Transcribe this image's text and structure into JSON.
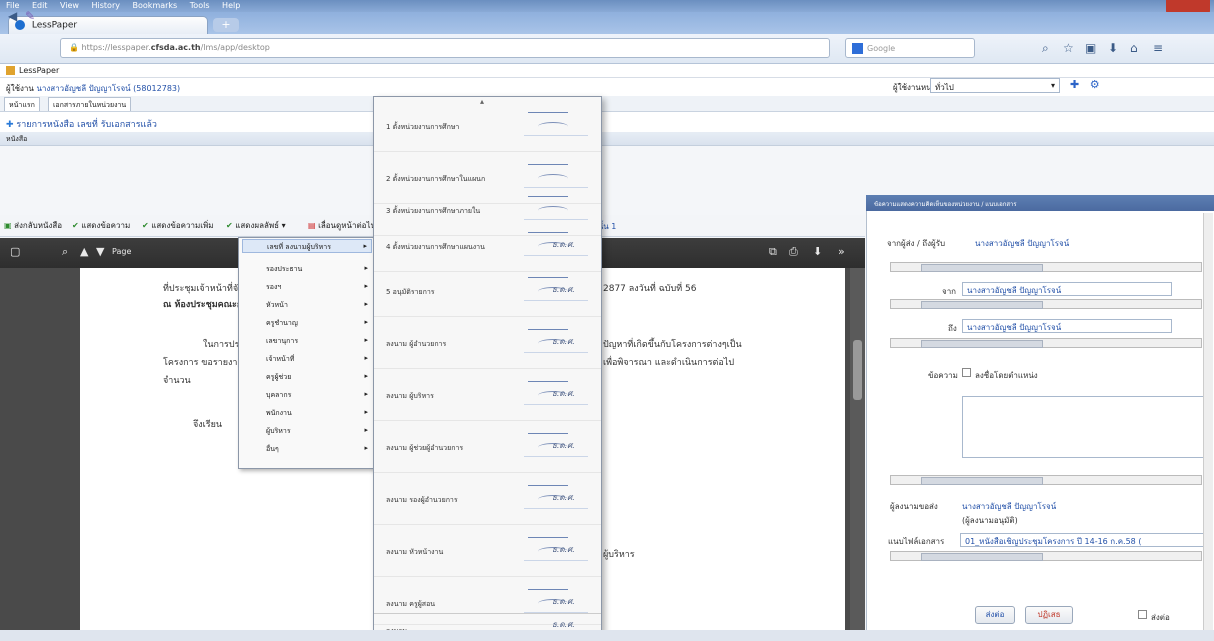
{
  "browser": {
    "menubar": [
      "File",
      "Edit",
      "View",
      "History",
      "Bookmarks",
      "Tools",
      "Help"
    ],
    "tab_title": "LessPaper",
    "url_prefix": "https://lesspaper.",
    "url_domain": "cfsda.ac.th",
    "url_suffix": "/lms/app/desktop",
    "search_placeholder": "Google"
  },
  "app": {
    "title": "LessPaper",
    "user_label": "ผู้ใช้งาน",
    "user_name": "นางสาวอัญชลี ปัญญาโรจน์ (58012783)",
    "unit_label": "ผู้ใช้งานหน่วยงาน",
    "unit_value": "ทั่วไป",
    "tabs": [
      "หน้าแรก",
      "เอกสารภายในหน่วยงาน"
    ],
    "received_title": "รายการหนังสือ เลขที่ รับเอกสารแล้ว",
    "bookrow": "หนังสือ"
  },
  "toolbar": {
    "btn1": "ส่งกลับหนังสือ",
    "btn2": "แสดงข้อความ",
    "btn3": "แสดงข้อความเพิ่ม",
    "btn4": "แสดงผลลัพธ์",
    "btn5": "เลื่อนดูหน้าต่อไป",
    "pagenav": "หน้าที่ 1  ใหม่  1  เท่านั้น  1"
  },
  "viewer": {
    "page_label": "Page",
    "text1": "ที่ประชุมเจ้าหน้าที่จัดการศึกษา",
    "text2": "ณ ห้องประชุมคณะกรรมการ",
    "text3": "ในการประชุมครั้งนี้",
    "text4": "โครงการ ขอรายงาน",
    "text5": "จำนวน",
    "text6": "จึงเรียน",
    "text7": "2877 ลงวันที่ ฉบับที่ 56",
    "text8": "ปัญหาที่เกิดขึ้นกับโครงการต่างๆเป็น",
    "text9": "เพื่อพิจารณา และดำเนินการต่อไป",
    "text10": "ผู้บริหาร"
  },
  "menu1": {
    "items": [
      "เลขที่ ลงนามผู้บริหาร",
      "รองประธาน",
      "รองฯ",
      "หัวหน้า",
      "ครูชำนาญ",
      "เลขานุการ",
      "เจ้าหน้าที่",
      "ครูผู้ช่วย",
      "บุคลากร",
      "พนักงาน",
      "ผู้บริหาร",
      "อื่นๆ"
    ]
  },
  "menu2": {
    "items": [
      "1 ตั้งหน่วยงานการศึกษา",
      "2 ตั้งหน่วยงานการศึกษาในแผนก",
      "3 ตั้งหน่วยงานการศึกษาภายใน",
      "4 ตั้งหน่วยงานการศึกษาแผนงาน",
      "5 อนุมัติรายการ",
      "ลงนาม ผู้อำนวยการ",
      "ลงนาม ผู้บริหาร",
      "ลงนาม ผู้ช่วยผู้อำนวยการ",
      "ลงนาม รองผู้อำนวยการ",
      "ลงนาม หัวหน้างาน",
      "ลงนาม ครูผู้สอน",
      "ลงนาม เจ้าหน้าที่",
      "ลงนาม"
    ],
    "sig_text": "ธ.ด.ศ."
  },
  "rpanel": {
    "header": "ข้อความแสดงความคิดเห็นของหน่วยงาน / แนบเอกสาร",
    "sender_label": "จากผู้ส่ง / ถึงผู้รับ",
    "sender_value": "นางสาวอัญชลี ปัญญาโรจน์",
    "from_label": "จาก",
    "from_value": "นางสาวอัญชลี ปัญญาโรจน์",
    "to_label": "ถึง",
    "to_value": "นางสาวอัญชลี ปัญญาโรจน์",
    "note_label": "ข้อความ",
    "note_check": "ลงชื่อโดยตำแหน่ง",
    "approver_label": "ผู้ลงนามขอส่ง",
    "approver_value": "นางสาวอัญชลี ปัญญาโรจน์",
    "approver_sub": "(ผู้ลงนามอนุมัติ)",
    "attach_label": "แนบไฟล์เอกสาร",
    "attach_value": "01_หนังสือเชิญประชุมโครงการ ปี 14-16 ก.ค.58 (",
    "send_btn": "ส่งต่อ",
    "reject_btn": "ปฏิเสธ",
    "check2": "ส่งต่อ"
  }
}
